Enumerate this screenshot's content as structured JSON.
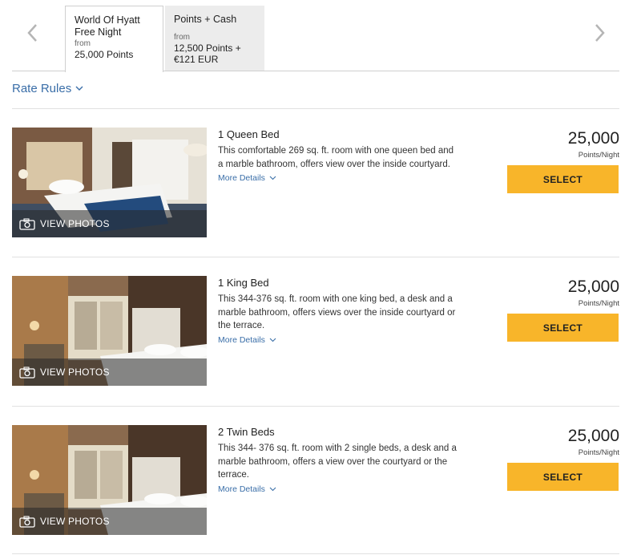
{
  "tabs": [
    {
      "title": "World Of Hyatt\nFree Night",
      "from": "from",
      "price": "25,000 Points",
      "active": true
    },
    {
      "title": "Points + Cash",
      "from": "from",
      "price": "12,500 Points +\n€121 EUR",
      "active": false
    }
  ],
  "rate_rules": {
    "label": "Rate Rules"
  },
  "rooms": [
    {
      "title": "1 Queen Bed",
      "description": "This comfortable 269 sq. ft. room with one queen bed and a marble bathroom, offers view over the inside courtyard.",
      "more_details": "More Details",
      "photo_label": "VIEW PHOTOS",
      "price": "25,000",
      "unit": "Points/Night",
      "button": "SELECT"
    },
    {
      "title": "1 King Bed",
      "description": "This 344-376 sq. ft. room with one king bed, a desk and a marble bathroom, offers views over the inside courtyard or the terrace.",
      "more_details": "More Details",
      "photo_label": "VIEW PHOTOS",
      "price": "25,000",
      "unit": "Points/Night",
      "button": "SELECT"
    },
    {
      "title": "2 Twin Beds",
      "description": "This 344- 376 sq. ft. room with 2 single beds, a desk and a marble bathroom, offers a view over the courtyard or the terrace.",
      "more_details": "More Details",
      "photo_label": "VIEW PHOTOS",
      "price": "25,000",
      "unit": "Points/Night",
      "button": "SELECT"
    }
  ],
  "icons": {
    "prev": "chevron-left-icon",
    "next": "chevron-right-icon",
    "dropdown": "chevron-down-icon",
    "camera": "camera-icon"
  },
  "colors": {
    "accent_button": "#f8b52a",
    "link": "#3a6ea8",
    "inactive_tab": "#ececec"
  }
}
